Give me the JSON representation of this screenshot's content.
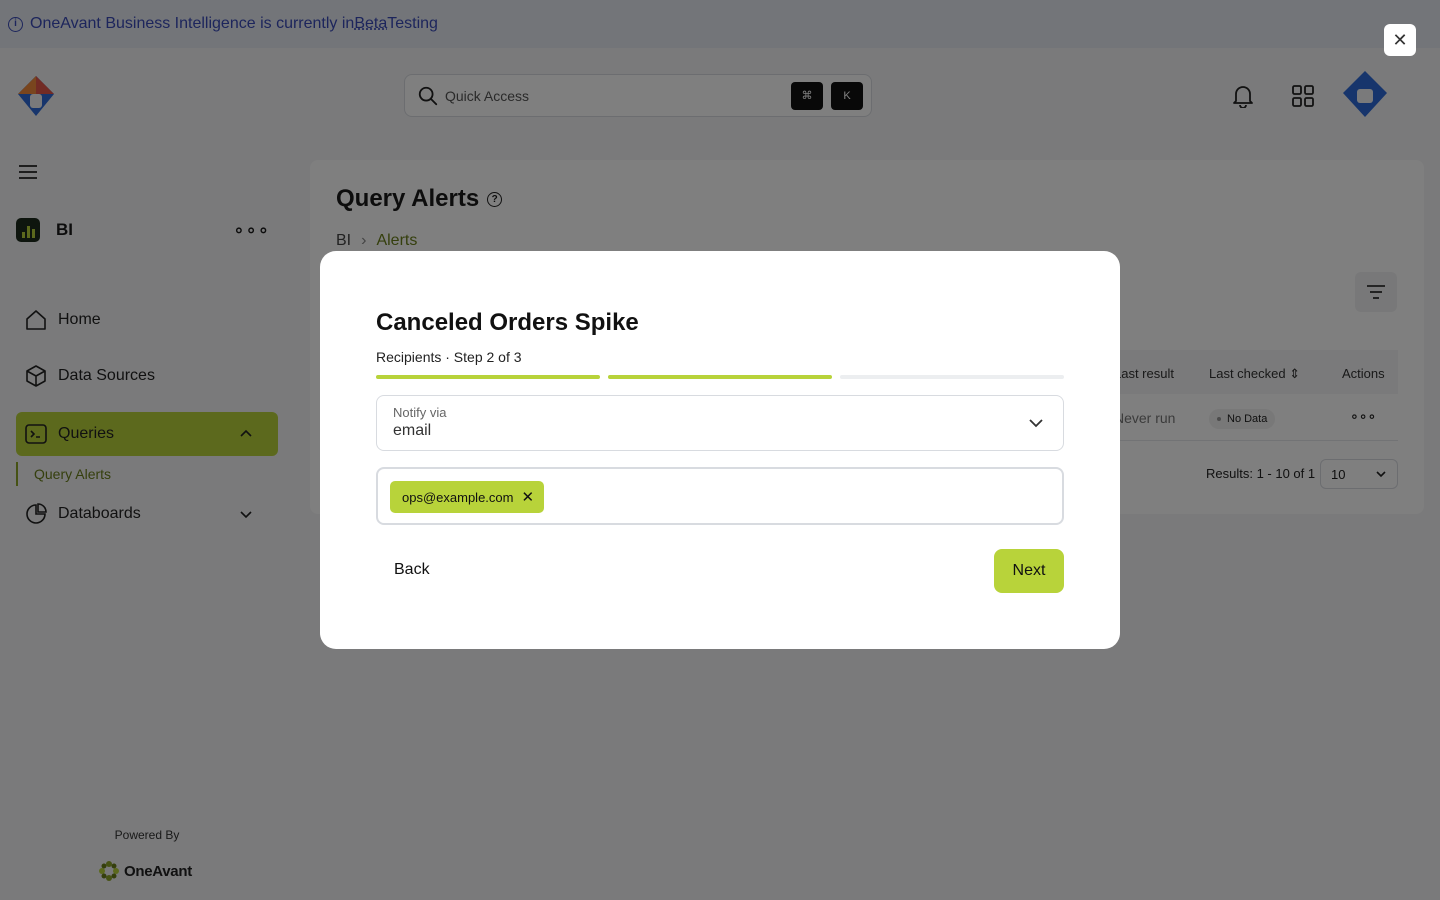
{
  "banner": {
    "text_before": "OneAvant Business Intelligence is currently in ",
    "beta": "Beta",
    "text_after": " Testing"
  },
  "header": {
    "search_placeholder": "Quick Access",
    "shortcut_keys": [
      "⌘",
      "K"
    ],
    "icons": [
      "bell-icon",
      "apps-grid-icon",
      "avatar-logo"
    ]
  },
  "sidebar": {
    "workspace": "BI",
    "items": [
      {
        "label": "Home",
        "icon": "home-icon"
      },
      {
        "label": "Data Sources",
        "icon": "cube-icon"
      },
      {
        "label": "Queries",
        "icon": "terminal-icon",
        "active": true,
        "expanded": true
      },
      {
        "label": "Databoards",
        "icon": "pie-chart-icon"
      }
    ],
    "subitems": [
      "Query Alerts"
    ],
    "powered_by": "Powered By",
    "brand": "OneAvant"
  },
  "main": {
    "title": "Query Alerts",
    "breadcrumb": [
      "BI",
      "Alerts"
    ],
    "table": {
      "headers": [
        "Last result",
        "Last checked",
        "Actions"
      ],
      "row": {
        "last_result": "Never run",
        "status": "No Data"
      }
    },
    "results": "Results: 1 - 10 of 1",
    "page_size": "10"
  },
  "modal": {
    "title": "Canceled Orders Spike",
    "subtitle": "Recipients · Step 2 of 3",
    "current_step": 2,
    "total_steps": 3,
    "notify_label": "Notify via",
    "notify_value": "email",
    "recipients": [
      "ops@example.com"
    ],
    "back_label": "Back",
    "next_label": "Next"
  },
  "colors": {
    "accent": "#b8d33a",
    "banner_bg": "#e6ebf2",
    "banner_text": "#3a4bb8",
    "logo_blue": "#2f6bd8"
  }
}
